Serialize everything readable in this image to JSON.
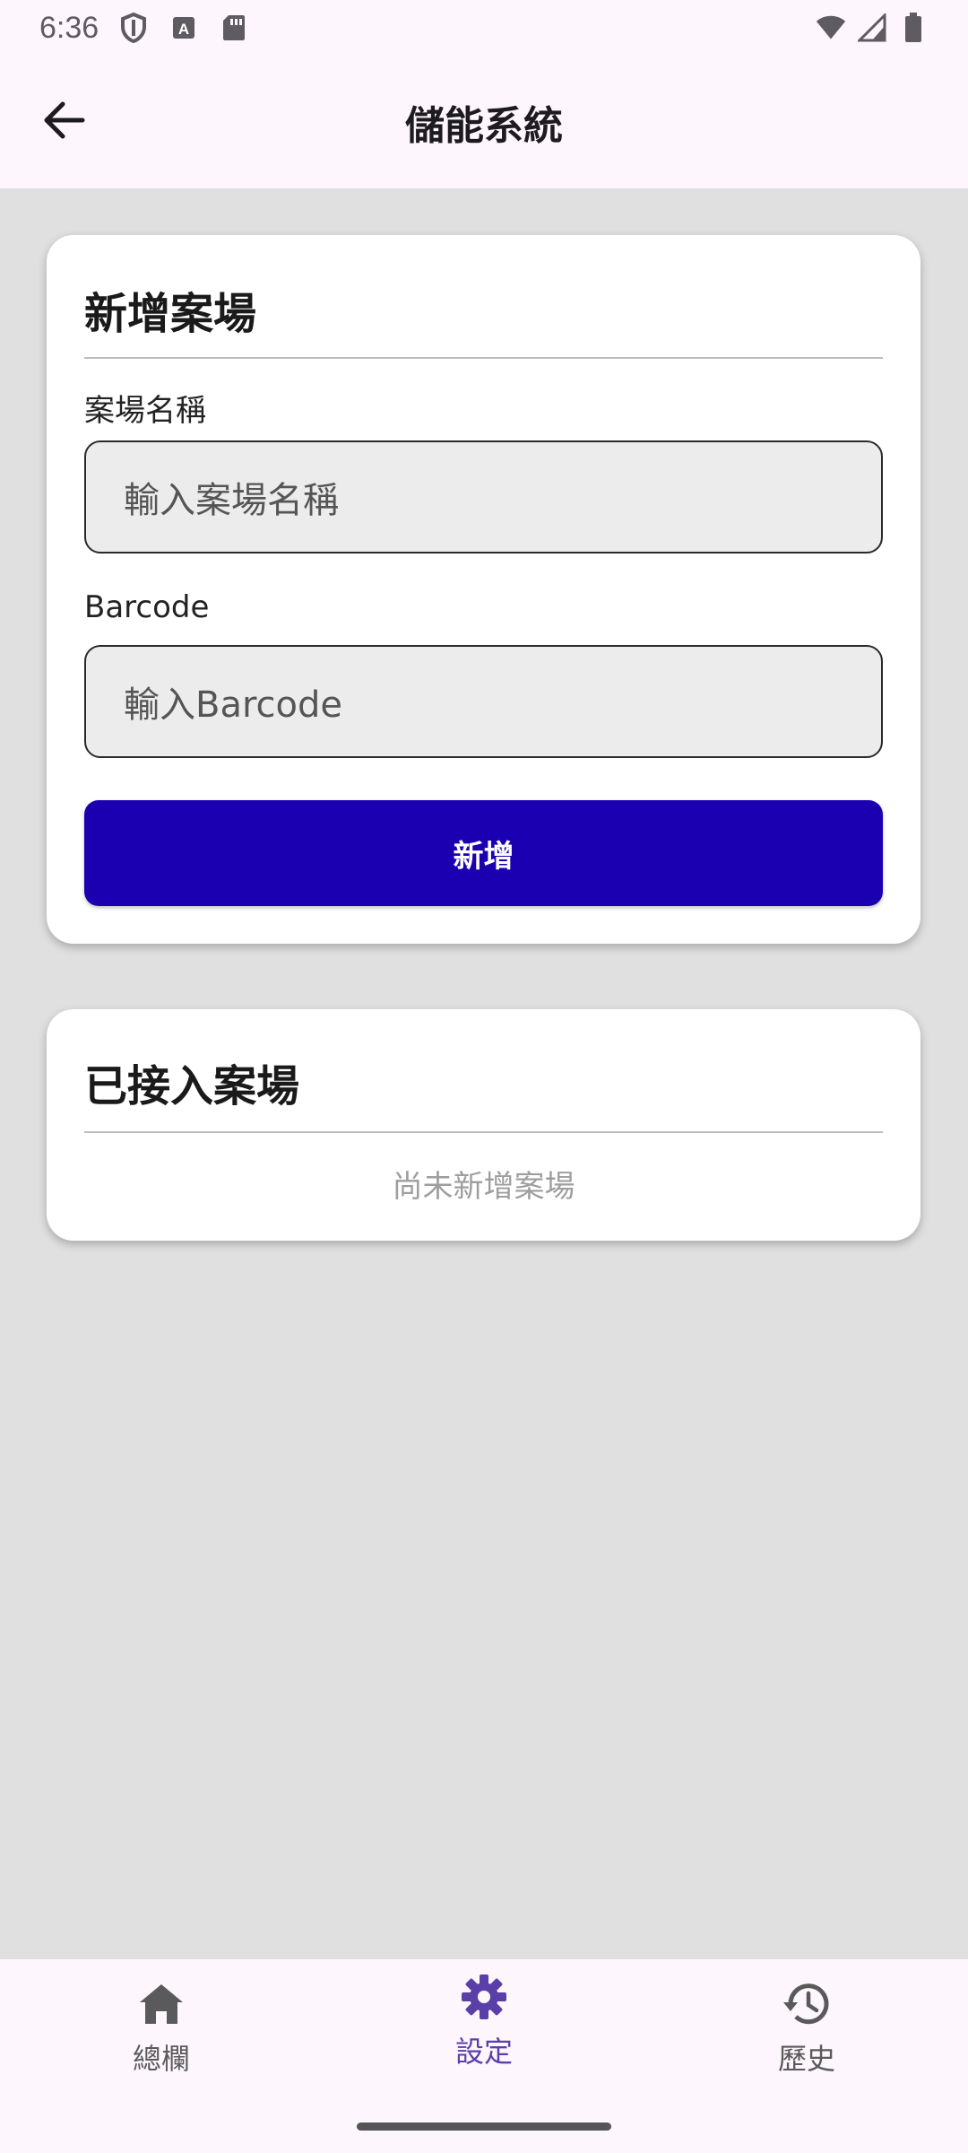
{
  "status_bar": {
    "time": "6:36",
    "icons_left": [
      "shield-icon",
      "font-a-icon",
      "sd-card-icon"
    ],
    "icons_right": [
      "wifi-icon",
      "cell-signal-icon",
      "battery-icon"
    ]
  },
  "app_bar": {
    "title": "儲能系統",
    "back_icon": "arrow-back-icon"
  },
  "add_site_card": {
    "title": "新增案場",
    "name_label": "案場名稱",
    "name_placeholder": "輸入案場名稱",
    "barcode_label": "Barcode",
    "barcode_placeholder": "輸入Barcode",
    "submit_label": "新增",
    "submit_color": "#1a00b0"
  },
  "connected_sites_card": {
    "title": "已接入案場",
    "empty_text": "尚未新增案場"
  },
  "bottom_nav": {
    "items": [
      {
        "label": "總欄",
        "icon": "home-icon",
        "active": false
      },
      {
        "label": "設定",
        "icon": "settings-icon",
        "active": true
      },
      {
        "label": "歷史",
        "icon": "history-icon",
        "active": false
      }
    ],
    "active_color": "#5b3fa8"
  }
}
